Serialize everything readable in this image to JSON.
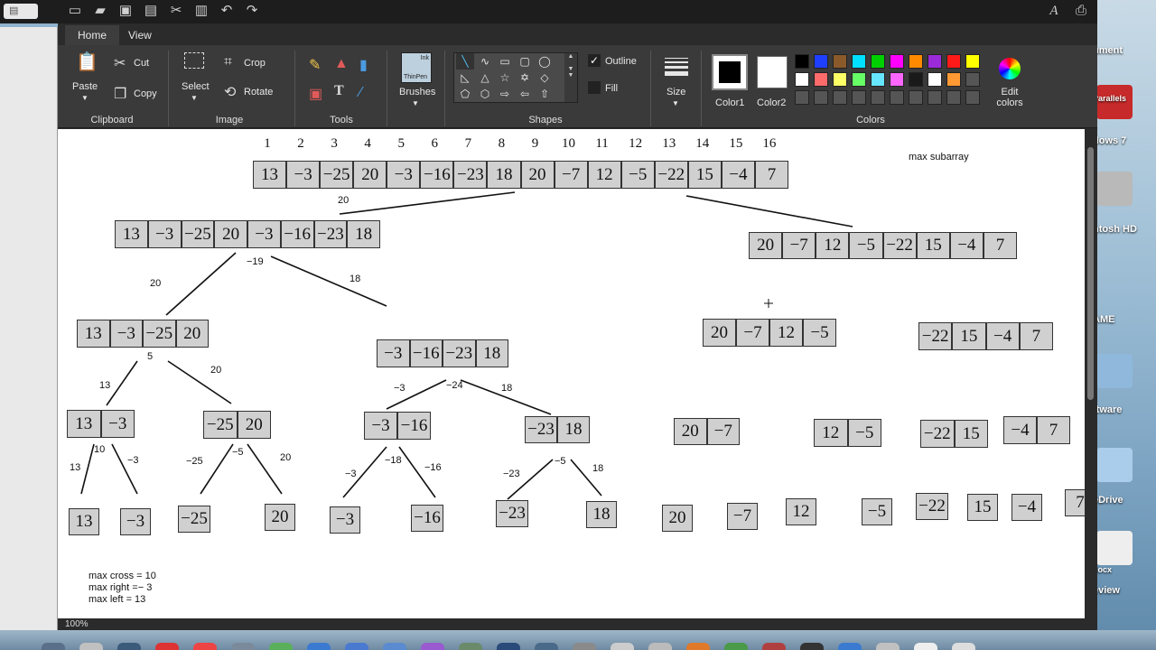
{
  "toolbar": {
    "sidebar_toggle": "▤",
    "icons": [
      "new-icon",
      "open-icon",
      "save-icon",
      "print-icon",
      "cut-icon",
      "paste-icon",
      "undo-icon",
      "redo-icon"
    ]
  },
  "app": {
    "tabs": [
      "Home",
      "View"
    ],
    "ribbon": {
      "clipboard": {
        "paste": "Paste",
        "cut": "Cut",
        "copy": "Copy",
        "label": "Clipboard"
      },
      "image": {
        "select": "Select",
        "crop": "Crop",
        "rotate": "Rotate",
        "label": "Image"
      },
      "tools": {
        "label": "Tools",
        "text_tool": "T"
      },
      "brushes": {
        "label": "Brushes",
        "thumb_top": "Ink",
        "thumb_bottom": "ThinPen"
      },
      "shapes": {
        "label": "Shapes",
        "outline": "Outline",
        "fill": "Fill"
      },
      "size": {
        "label": "Size"
      },
      "colors": {
        "color1": "Color1",
        "color2": "Color2",
        "edit": "Edit colors",
        "label": "Colors",
        "swatches": [
          "#000000",
          "#1f3fff",
          "#8a5a2b",
          "#00e0ff",
          "#00d000",
          "#ff00ff",
          "#ff8a00",
          "#9b2bd8",
          "#ff1a1a",
          "#ffff00",
          "#ffffff",
          "#ff6b6b",
          "#ffff66",
          "#66ff66",
          "#66e6ff",
          "#ff66ff",
          "#1a1a1a",
          "#ffffff",
          "#ff9933",
          "#555555"
        ]
      }
    },
    "status": {
      "zoom": "100%"
    }
  },
  "canvas": {
    "title": "max subarray",
    "indices": [
      "1",
      "2",
      "3",
      "4",
      "5",
      "6",
      "7",
      "8",
      "9",
      "10",
      "11",
      "12",
      "13",
      "14",
      "15",
      "16"
    ],
    "root": [
      "13",
      "−3",
      "−25",
      "20",
      "−3",
      "−16",
      "−23",
      "18",
      "20",
      "−7",
      "12",
      "−5",
      "−22",
      "15",
      "−4",
      "7"
    ],
    "left_half": [
      "13",
      "−3",
      "−25",
      "20",
      "−3",
      "−16",
      "−23",
      "18"
    ],
    "right_half": [
      "20",
      "−7",
      "12",
      "−5",
      "−22",
      "15",
      "−4",
      "7"
    ],
    "q1": [
      "13",
      "−3",
      "−25",
      "20"
    ],
    "q2": [
      "−3",
      "−16",
      "−23",
      "18"
    ],
    "q3": [
      "20",
      "−7",
      "12",
      "−5"
    ],
    "q4": [
      "−22",
      "15",
      "−4",
      "7"
    ],
    "e1": [
      "13",
      "−3"
    ],
    "e2": [
      "−25",
      "20"
    ],
    "e3": [
      "−3",
      "−16"
    ],
    "e4": [
      "−23",
      "18"
    ],
    "e5": [
      "20",
      "−7"
    ],
    "e6": [
      "12",
      "−5"
    ],
    "e7": [
      "−22",
      "15"
    ],
    "e8": [
      "−4",
      "7"
    ],
    "leaves": [
      "13",
      "−3",
      "−25",
      "20",
      "−3",
      "−16",
      "−23",
      "18",
      "20",
      "−7",
      "12",
      "−5",
      "−22",
      "15",
      "−4",
      "7"
    ],
    "annotations": {
      "a_root_left": "20",
      "a_l_left": "20",
      "a_l_mid": "−19",
      "a_l_right": "18",
      "a_q1_left": "13",
      "a_q1_mid": "5",
      "a_q1_right": "20",
      "a_q2_left": "−3",
      "a_q2_mid": "−24",
      "a_q2_right": "18",
      "a_e1_left": "13",
      "a_e1_mid": "10",
      "a_e1_right": "−3",
      "a_e2_left": "−25",
      "a_e2_mid": "−5",
      "a_e2_right": "20",
      "a_e3_left": "−3",
      "a_e3_mid": "−18",
      "a_e3_right": "−16",
      "a_e4_left": "−23",
      "a_e4_mid": "−5",
      "a_e4_right": "18"
    },
    "notes": {
      "max_cross": "max cross = 10",
      "max_right": "max right =− 3",
      "max_left": "max left = 13"
    }
  },
  "desktop": {
    "labels": [
      "ument",
      "Parallels",
      "dows 7",
      "ntosh HD",
      "AME",
      "ftware",
      "eDrive",
      "docx",
      "eview"
    ]
  }
}
